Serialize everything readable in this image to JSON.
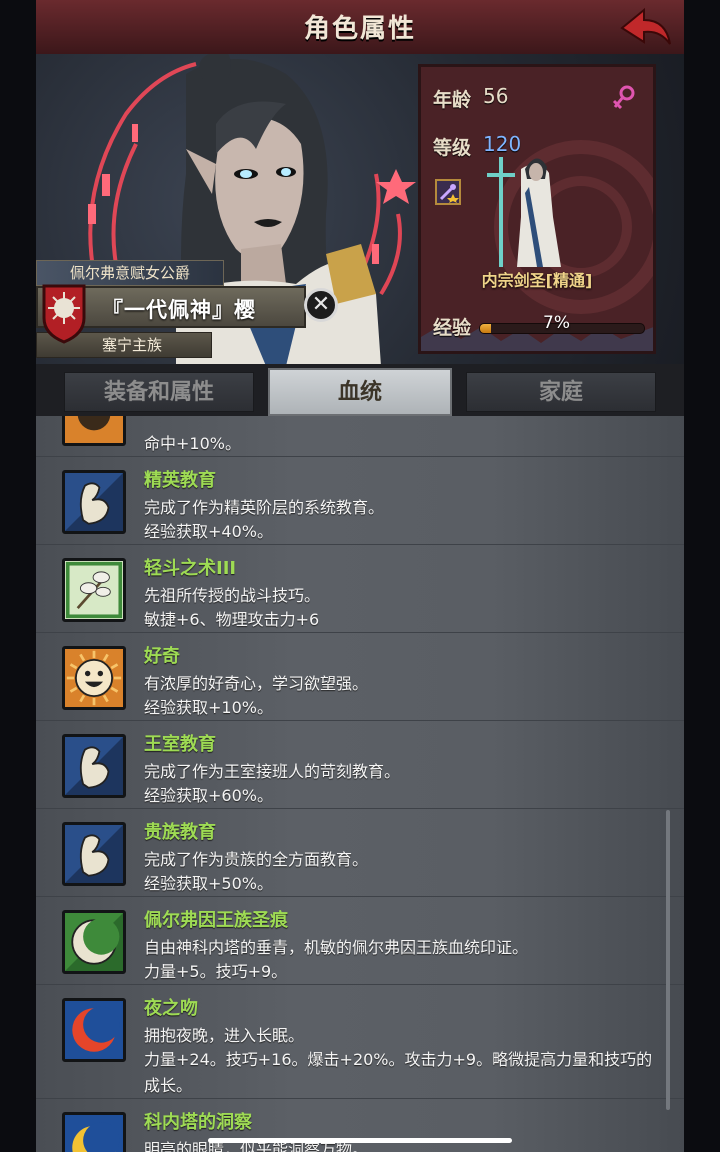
{
  "header": {
    "title": "角色属性"
  },
  "character": {
    "title_ribbon": "佩尔弗意赋女公爵",
    "name": "『一代佩神』樱",
    "family": "塞宁主族"
  },
  "stats": {
    "age_label": "年龄",
    "age_value": "56",
    "level_label": "等级",
    "level_value": "120",
    "job": "内宗剑圣[精通]",
    "exp_label": "经验",
    "exp_percent": "7%",
    "exp_fraction": 0.07
  },
  "tabs": [
    {
      "label": "装备和属性"
    },
    {
      "label": "血统"
    },
    {
      "label": "家庭"
    }
  ],
  "traits": [
    {
      "name": "",
      "desc": "命中+10%。",
      "effect": "",
      "icon": "partial-trait-icon",
      "color": "#d9822b"
    },
    {
      "name": "精英教育",
      "desc": "完成了作为精英阶层的系统教育。",
      "effect": "经验获取+40%。",
      "icon": "muscle-arm-icon",
      "color": "#2a4f8a"
    },
    {
      "name": "轻斗之术III",
      "desc": "先祖所传授的战斗技巧。",
      "effect": "敏捷+6、物理攻击力+6",
      "icon": "leaf-branch-icon",
      "color": "#3e8a3a"
    },
    {
      "name": "好奇",
      "desc": "有浓厚的好奇心，学习欲望强。",
      "effect": "经验获取+10%。",
      "icon": "smiley-face-icon",
      "color": "#d9822b"
    },
    {
      "name": "王室教育",
      "desc": "完成了作为王室接班人的苛刻教育。",
      "effect": "经验获取+60%。",
      "icon": "muscle-arm-icon",
      "color": "#2a4f8a"
    },
    {
      "name": "贵族教育",
      "desc": "完成了作为贵族的全方面教育。",
      "effect": "经验获取+50%。",
      "icon": "muscle-arm-icon",
      "color": "#2a4f8a"
    },
    {
      "name": "佩尔弗因王族圣痕",
      "desc": "自由神科内塔的垂青，机敏的佩尔弗因王族血统印证。",
      "effect": "力量+5。技巧+9。",
      "icon": "crescent-mark-icon",
      "color": "#3e8a3a"
    },
    {
      "name": "夜之吻",
      "desc": "拥抱夜晚，进入长眠。",
      "effect": "力量+24。技巧+16。爆击+20%。攻击力+9。略微提高力量和技巧的成长。",
      "icon": "red-crescent-icon",
      "color": "#1f4f9a"
    },
    {
      "name": "科内塔的洞察",
      "desc": "明亮的眼睛，似乎能洞察万物。",
      "effect": "",
      "icon": "yellow-crescent-icon",
      "color": "#1f4f9a"
    }
  ],
  "colors": {
    "trait_name": "#9edb54",
    "level_value": "#7fb4ff",
    "job_title": "#f0d48a",
    "exp_fill": "#f0b040",
    "gender": "#e055b0"
  }
}
